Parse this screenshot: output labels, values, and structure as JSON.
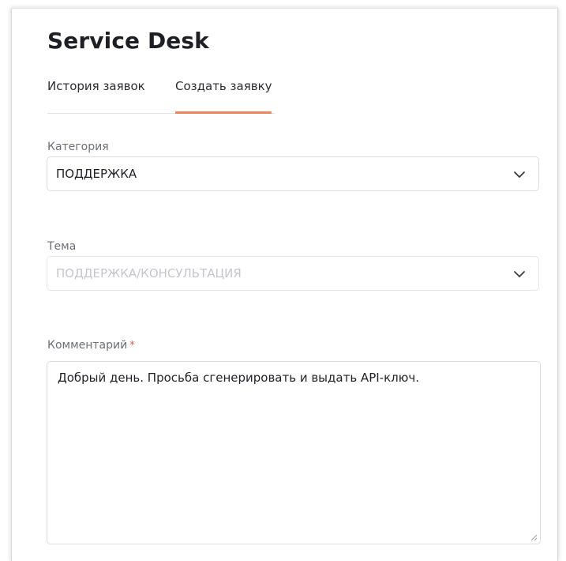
{
  "header": {
    "title": "Service Desk"
  },
  "tabs": [
    {
      "label": "История заявок",
      "active": false
    },
    {
      "label": "Создать заявку",
      "active": true
    }
  ],
  "form": {
    "category": {
      "label": "Категория",
      "value": "ПОДДЕРЖКА",
      "icon": "chevron-down-icon"
    },
    "theme": {
      "label": "Тема",
      "value": "ПОДДЕРЖКА/КОНСУЛЬТАЦИЯ",
      "disabled": true,
      "icon": "chevron-down-icon"
    },
    "comment": {
      "label": "Комментарий",
      "required_mark": "*",
      "value": "Добрый день. Просьба сгенерировать и выдать API-ключ."
    }
  },
  "colors": {
    "accent": "#f0845e",
    "required": "#e05a4d",
    "disabled_text": "#c4c6cb"
  }
}
